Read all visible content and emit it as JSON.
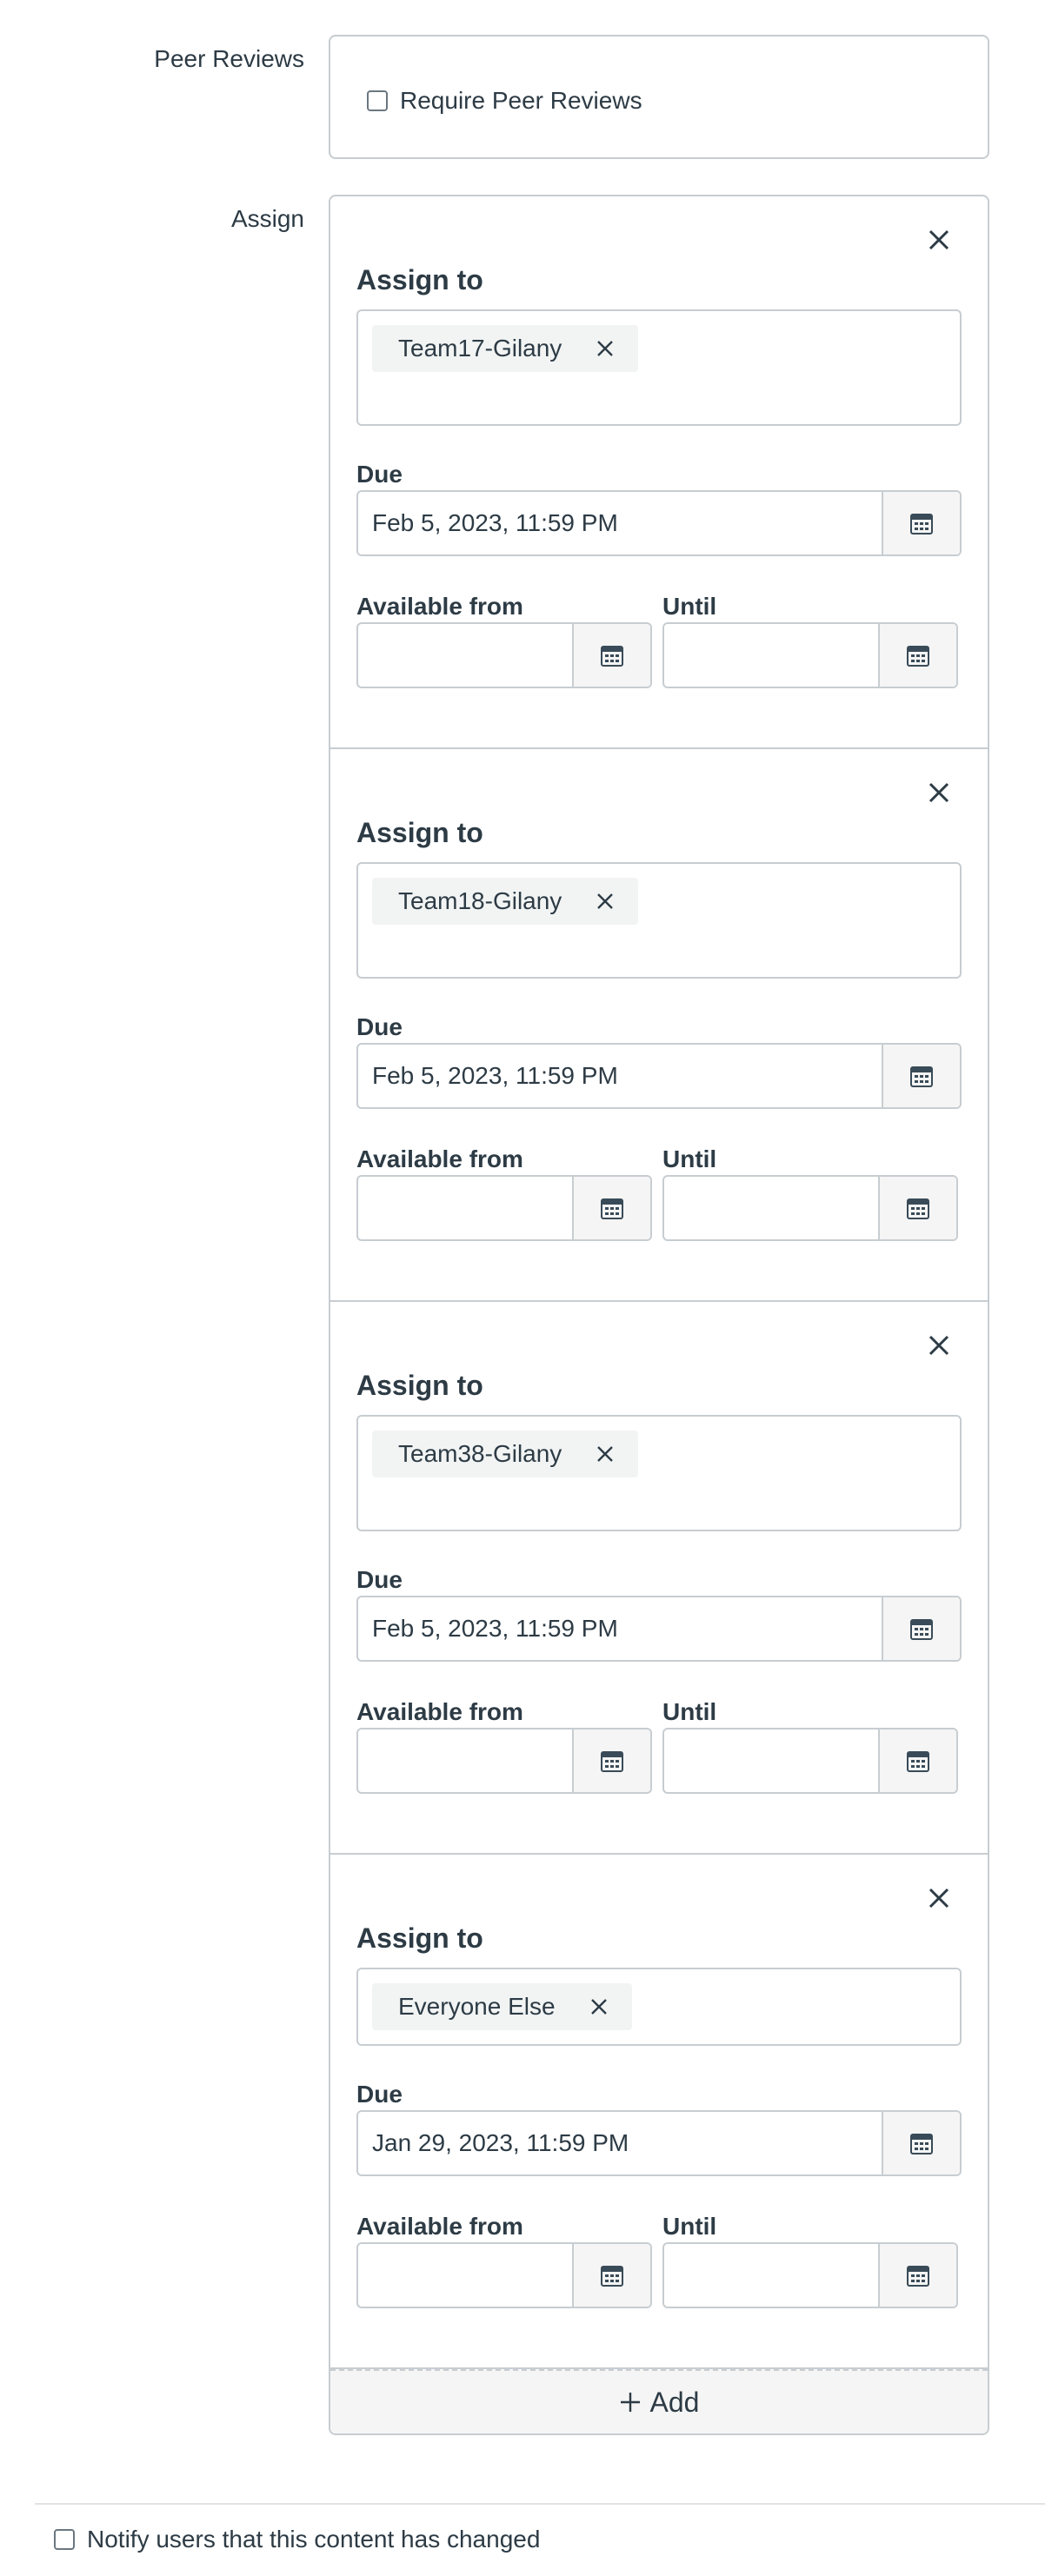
{
  "peer_reviews": {
    "label": "Peer Reviews",
    "checkbox_label": "Require Peer Reviews",
    "checked": false
  },
  "assign": {
    "label": "Assign",
    "cards": [
      {
        "title": "Assign to",
        "token": "Team17-Gilany",
        "due_label": "Due",
        "due_value": "Feb 5, 2023, 11:59 PM",
        "available_label": "Available from",
        "available_value": "",
        "until_label": "Until",
        "until_value": ""
      },
      {
        "title": "Assign to",
        "token": "Team18-Gilany",
        "due_label": "Due",
        "due_value": "Feb 5, 2023, 11:59 PM",
        "available_label": "Available from",
        "available_value": "",
        "until_label": "Until",
        "until_value": ""
      },
      {
        "title": "Assign to",
        "token": "Team38-Gilany",
        "due_label": "Due",
        "due_value": "Feb 5, 2023, 11:59 PM",
        "available_label": "Available from",
        "available_value": "",
        "until_label": "Until",
        "until_value": ""
      },
      {
        "title": "Assign to",
        "token": "Everyone Else",
        "due_label": "Due",
        "due_value": "Jan 29, 2023, 11:59 PM",
        "available_label": "Available from",
        "available_value": "",
        "until_label": "Until",
        "until_value": ""
      }
    ],
    "add_label": "Add"
  },
  "notify": {
    "label": "Notify users that this content has changed",
    "checked": false
  },
  "colors": {
    "text": "#2d3b45",
    "border": "#c7cdd1",
    "token_bg": "#f2f4f4",
    "button_bg": "#f5f5f5"
  }
}
